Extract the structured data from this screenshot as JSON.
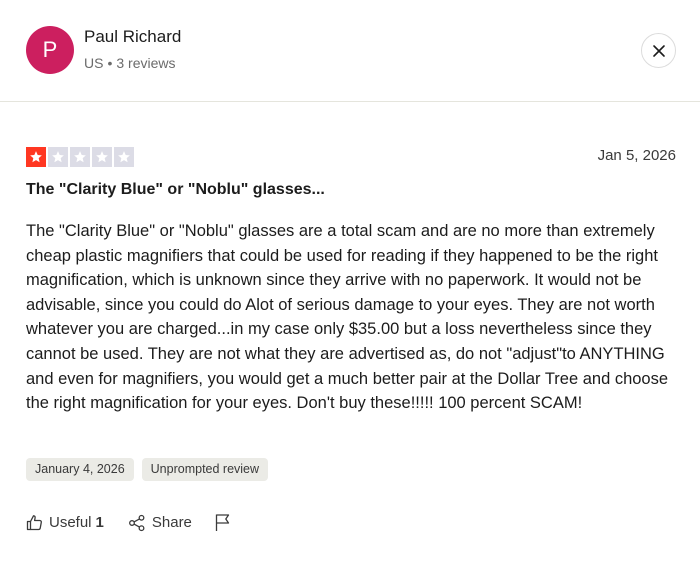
{
  "reviewer": {
    "initial": "P",
    "name": "Paul Richard",
    "country": "US",
    "separator": "•",
    "reviews_count": "3 reviews",
    "avatar_color": "#cc1f5f"
  },
  "review": {
    "rating": 1,
    "max_rating": 5,
    "star_color": "#ff3722",
    "date": "Jan 5, 2026",
    "title": "The \"Clarity Blue\" or \"Noblu\" glasses...",
    "body": "The \"Clarity Blue\" or \"Noblu\" glasses are a total scam and are no more than extremely cheap plastic magnifiers that could be used for reading if they happened to be the right magnification, which is unknown since they arrive with no paperwork. It would not be advisable, since you could do Alot of serious damage to your eyes. They are not worth whatever you are charged...in my case only $35.00 but a loss nevertheless since they cannot be used. They are not what they are advertised as, do not \"adjust\"to ANYTHING and even for magnifiers, you would get a much better pair at the Dollar Tree and choose the right magnification for your eyes. Don't buy these!!!!! 100 percent SCAM!",
    "tags": [
      "January 4, 2026",
      "Unprompted review"
    ]
  },
  "actions": {
    "useful_label": "Useful",
    "useful_count": "1",
    "share_label": "Share"
  },
  "icons": {
    "close": "close-icon",
    "star": "star-icon",
    "thumbs_up": "thumbs-up-icon",
    "share": "share-icon",
    "flag": "flag-icon"
  }
}
